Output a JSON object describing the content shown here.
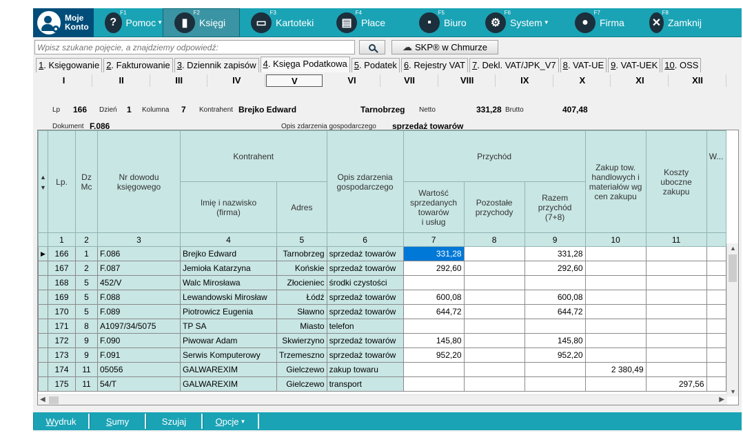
{
  "account": {
    "line1": "Moje",
    "line2": "Konto"
  },
  "toolbar": [
    {
      "key": "F1",
      "label": "Pomoc",
      "icon": "?",
      "dropdown": true,
      "width": 100
    },
    {
      "key": "F2",
      "label": "Księgi",
      "icon": "▮",
      "dropdown": false,
      "width": 112,
      "active": true
    },
    {
      "key": "F3",
      "label": "Kartoteki",
      "icon": "▭",
      "dropdown": false,
      "width": 124
    },
    {
      "key": "F4",
      "label": "Płace",
      "icon": "▤",
      "dropdown": false,
      "width": 120
    },
    {
      "key": "F5",
      "label": "Biuro",
      "icon": "▪",
      "dropdown": false,
      "width": 96
    },
    {
      "key": "F6",
      "label": "System",
      "icon": "⚙",
      "dropdown": true,
      "width": 130
    },
    {
      "key": "F7",
      "label": "Firma",
      "icon": "●",
      "dropdown": false,
      "width": 108
    },
    {
      "key": "F8",
      "label": "Zamknij",
      "icon": "✕",
      "dropdown": false,
      "width": 92
    }
  ],
  "search": {
    "placeholder": "Wpisz szukane pojęcie, a znajdziemy odpowiedź:"
  },
  "skp_label": "SKP® w Chmurze",
  "tabs": [
    {
      "num": "1",
      "label": ". Księgowanie"
    },
    {
      "num": "2",
      "label": ". Fakturowanie"
    },
    {
      "num": "3",
      "label": ". Dziennik zapisów"
    },
    {
      "num": "4",
      "label": ". Księga Podatkowa",
      "active": true
    },
    {
      "num": "5",
      "label": ". Podatek"
    },
    {
      "num": "6",
      "label": ". Rejestry VAT"
    },
    {
      "num": "7",
      "label": ". Dekl. VAT/JPK_V7"
    },
    {
      "num": "8",
      "label": ". VAT-UE"
    },
    {
      "num": "9",
      "label": ". VAT-UEK"
    },
    {
      "num": "10",
      "label": ". OSS"
    }
  ],
  "months": [
    "I",
    "II",
    "III",
    "IV",
    "V",
    "VI",
    "VII",
    "VIII",
    "IX",
    "X",
    "XI",
    "XII"
  ],
  "active_month": "V",
  "detail": {
    "lp_label": "Lp",
    "lp": "166",
    "dzien_label": "Dzień",
    "dzien": "1",
    "kolumna_label": "Kolumna",
    "kolumna": "7",
    "kontrahent_label": "Kontrahent",
    "kontrahent": "Brejko Edward",
    "miasto": "Tarnobrzeg",
    "netto_label": "Netto",
    "netto": "331,28",
    "brutto_label": "Brutto",
    "brutto": "407,48",
    "dokument_label": "Dokument",
    "dokument": "F.086",
    "opis_label": "Opis zdarzenia gospodarczego",
    "opis": "sprzedaż towarów"
  },
  "headers": {
    "lp": "Lp.",
    "dz": "Dz\nMc",
    "nr": "Nr dowodu\nksięgowego",
    "kontrahent": "Kontrahent",
    "imie": "Imię i nazwisko\n(firma)",
    "adres": "Adres",
    "opis": "Opis zdarzenia\ngospodarczego",
    "przychod": "Przychód",
    "wartosc": "Wartość\nsprzedanych\ntowarów\ni usług",
    "pozostale": "Pozostałe\nprzychody",
    "razem": "Razem\nprzychód\n(7+8)",
    "zakup": "Zakup tow.\nhandlowych i\nmateriałów wg\ncen zakupu",
    "koszty": "Koszty\nuboczne\nzakupu",
    "w": "W..."
  },
  "col_numbers": [
    "1",
    "2",
    "3",
    "4",
    "5",
    "6",
    "7",
    "8",
    "9",
    "10",
    "11"
  ],
  "rows": [
    {
      "lp": "166",
      "dz": "1",
      "nr": "F.086",
      "imie": "Brejko Edward",
      "adres": "Tarnobrzeg",
      "opis": "sprzedaż towarów",
      "c7": "331,28",
      "c8": "",
      "c9": "331,28",
      "c10": "",
      "c11": "",
      "current": true
    },
    {
      "lp": "167",
      "dz": "2",
      "nr": "F.087",
      "imie": "Jemioła Katarzyna",
      "adres": "Końskie",
      "opis": "sprzedaż towarów",
      "c7": "292,60",
      "c8": "",
      "c9": "292,60",
      "c10": "",
      "c11": ""
    },
    {
      "lp": "168",
      "dz": "5",
      "nr": "452/V",
      "imie": "Walc Mirosława",
      "adres": "Złocieniec",
      "opis": "środki czystości",
      "c7": "",
      "c8": "",
      "c9": "",
      "c10": "",
      "c11": ""
    },
    {
      "lp": "169",
      "dz": "5",
      "nr": "F.088",
      "imie": "Lewandowski Mirosław",
      "adres": "Łódź",
      "opis": "sprzedaż towarów",
      "c7": "600,08",
      "c8": "",
      "c9": "600,08",
      "c10": "",
      "c11": ""
    },
    {
      "lp": "170",
      "dz": "5",
      "nr": "F.089",
      "imie": "Piotrowicz Eugenia",
      "adres": "Sławno",
      "opis": "sprzedaż towarów",
      "c7": "644,72",
      "c8": "",
      "c9": "644,72",
      "c10": "",
      "c11": ""
    },
    {
      "lp": "171",
      "dz": "8",
      "nr": "A1097/34/5075",
      "imie": "TP SA",
      "adres": "Miasto",
      "opis": "telefon",
      "c7": "",
      "c8": "",
      "c9": "",
      "c10": "",
      "c11": ""
    },
    {
      "lp": "172",
      "dz": "9",
      "nr": "F.090",
      "imie": "Piwowar Adam",
      "adres": "Skwierzyno",
      "opis": "sprzedaż towarów",
      "c7": "145,80",
      "c8": "",
      "c9": "145,80",
      "c10": "",
      "c11": ""
    },
    {
      "lp": "173",
      "dz": "9",
      "nr": "F.091",
      "imie": "Serwis Komputerowy",
      "adres": "Trzemeszno",
      "opis": "sprzedaż towarów",
      "c7": "952,20",
      "c8": "",
      "c9": "952,20",
      "c10": "",
      "c11": ""
    },
    {
      "lp": "174",
      "dz": "11",
      "nr": "05056",
      "imie": "GALWAREXIM",
      "adres": "Gielczewo",
      "opis": "zakup towaru",
      "c7": "",
      "c8": "",
      "c9": "",
      "c10": "2 380,49",
      "c11": ""
    },
    {
      "lp": "175",
      "dz": "11",
      "nr": "54/T",
      "imie": "GALWAREXIM",
      "adres": "Gielczewo",
      "opis": "transport",
      "c7": "",
      "c8": "",
      "c9": "",
      "c10": "",
      "c11": "297,56"
    }
  ],
  "bottom_buttons": [
    {
      "u": "W",
      "rest": "ydruk",
      "width": 82
    },
    {
      "u": "S",
      "rest": "umy",
      "width": 82
    },
    {
      "u": "j",
      "pre": "Szu",
      "rest": "",
      "label": "Szukaj",
      "width": 82
    },
    {
      "u": "O",
      "rest": "pcje",
      "dropdown": true,
      "width": 82
    }
  ]
}
